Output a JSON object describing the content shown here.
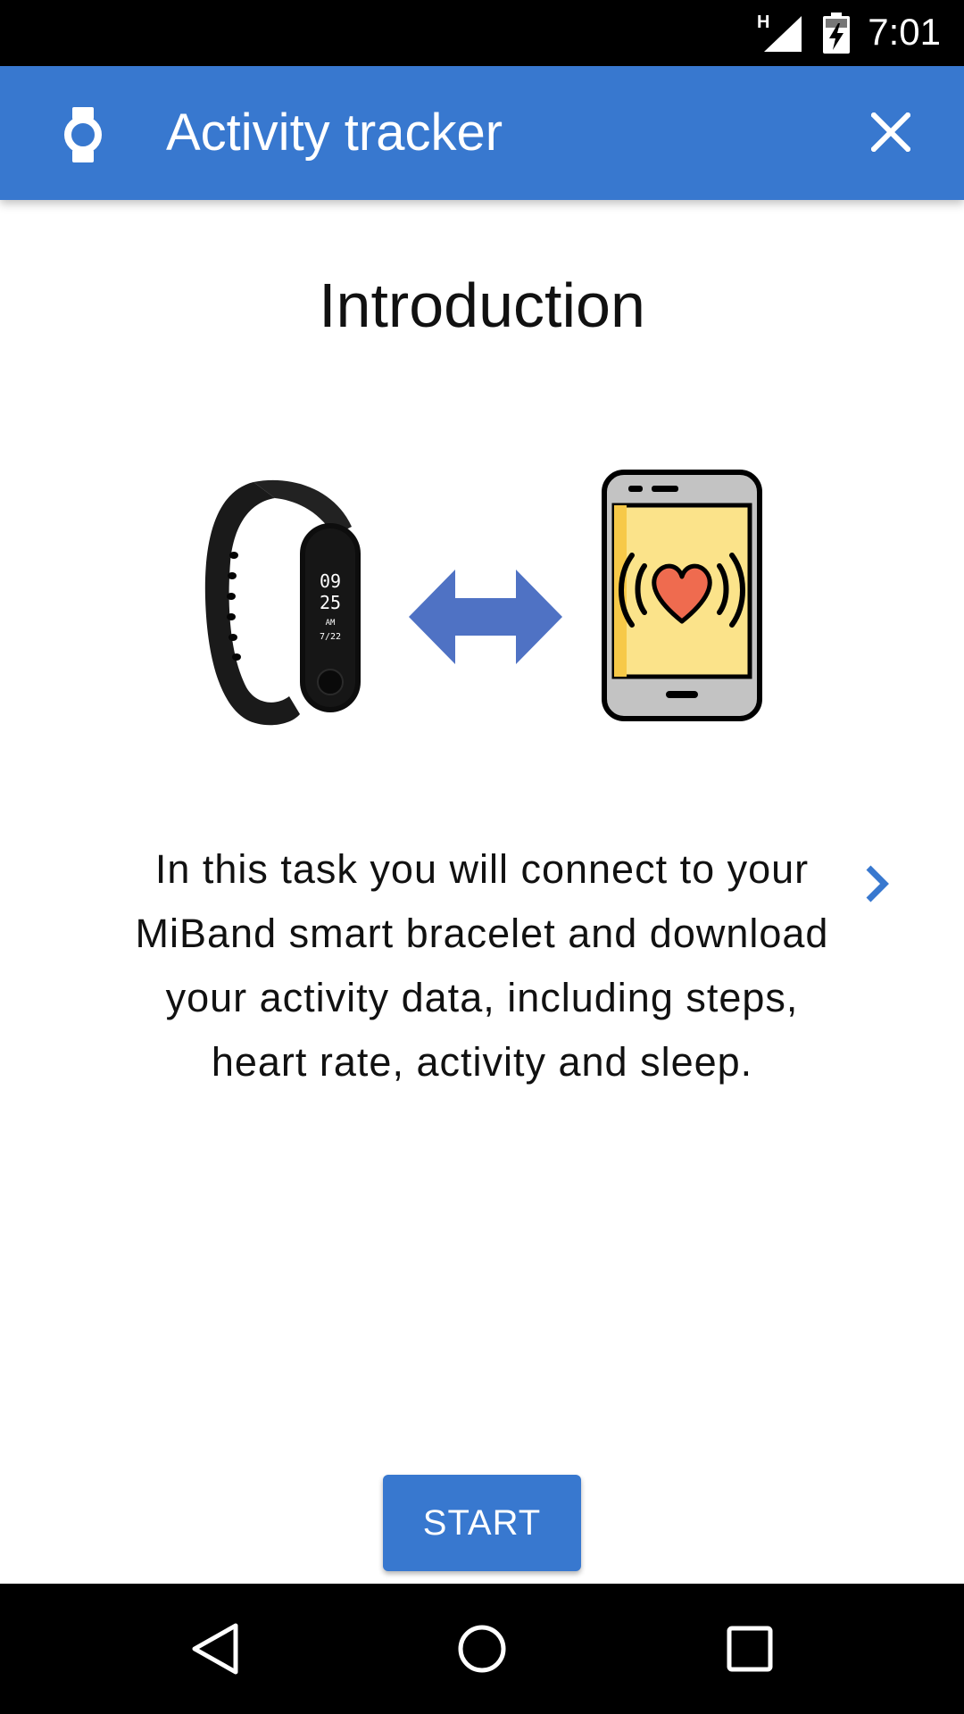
{
  "status_bar": {
    "network_type": "H",
    "time": "7:01",
    "icons": [
      "signal-icon",
      "battery-charging-icon"
    ]
  },
  "app_bar": {
    "title": "Activity tracker",
    "icons": [
      "watch-icon",
      "close-icon"
    ]
  },
  "content": {
    "heading": "Introduction",
    "illustration": {
      "band_screen_lines": [
        "09",
        "25",
        "AM",
        "7/22"
      ],
      "icons": [
        "fitness-band-image",
        "double-arrow-icon",
        "phone-heart-image"
      ]
    },
    "description": "In this task you will connect to your MiBand smart bracelet and download your activity data, including steps, heart rate, activity and sleep.",
    "next_icon": "chevron-right-icon"
  },
  "actions": {
    "start_label": "START"
  },
  "nav_bar": {
    "icons": [
      "back-icon",
      "home-icon",
      "recents-icon"
    ]
  },
  "colors": {
    "primary": "#3878cf",
    "arrow": "#4f72c4",
    "phone_screen": "#fbe38a",
    "heart": "#ef6b4f",
    "status_bar": "#000000",
    "nav_bar": "#000000"
  }
}
